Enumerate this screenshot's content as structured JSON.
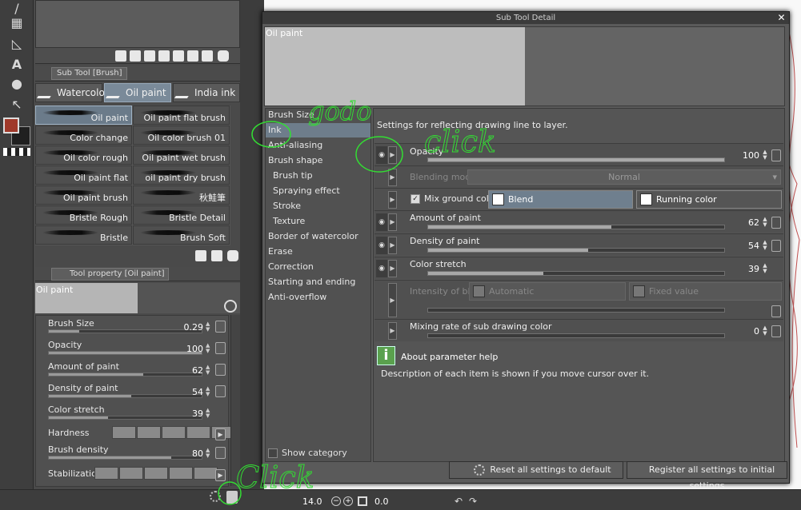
{
  "layer_strip": {},
  "subtool": {
    "tab_label": "Sub Tool [Brush]",
    "groups": [
      {
        "label": "Watercolor"
      },
      {
        "label": "Oil paint"
      },
      {
        "label": "India ink"
      }
    ],
    "brushes": [
      {
        "label": "Oil paint"
      },
      {
        "label": "Oil paint flat brush"
      },
      {
        "label": "Color change"
      },
      {
        "label": "Oil color brush 01"
      },
      {
        "label": "Oil color rough brush"
      },
      {
        "label": "Oil paint wet brush"
      },
      {
        "label": "Oil paint flat"
      },
      {
        "label": "oil paint dry brush"
      },
      {
        "label": "Oil paint brush"
      },
      {
        "label": "秋鮭筆"
      },
      {
        "label": "Bristle Rough"
      },
      {
        "label": "Bristle Detail"
      },
      {
        "label": "Bristle"
      },
      {
        "label": "Brush Soft"
      }
    ]
  },
  "tool_property": {
    "tab_label": "Tool property [Oil paint]",
    "preview_label": "Oil paint",
    "rows": [
      {
        "label": "Brush Size",
        "value": "0.29",
        "fill": 0.2
      },
      {
        "label": "Opacity",
        "value": "100",
        "fill": 1.0
      },
      {
        "label": "Amount of paint",
        "value": "62",
        "fill": 0.62
      },
      {
        "label": "Density of paint",
        "value": "54",
        "fill": 0.54
      },
      {
        "label": "Color stretch",
        "value": "39",
        "fill": 0.39
      },
      {
        "label": "Hardness"
      },
      {
        "label": "Brush density",
        "value": "80",
        "fill": 0.8
      },
      {
        "label": "Stabilization"
      }
    ]
  },
  "dialog": {
    "title": "Sub Tool Detail",
    "preview_label": "Oil paint",
    "categories": [
      {
        "label": "Brush Size"
      },
      {
        "label": "Ink"
      },
      {
        "label": "Anti-aliasing"
      },
      {
        "label": "Brush shape"
      },
      {
        "label": "Brush tip"
      },
      {
        "label": "Spraying effect"
      },
      {
        "label": "Stroke"
      },
      {
        "label": "Texture"
      },
      {
        "label": "Border of watercolor"
      },
      {
        "label": "Erase"
      },
      {
        "label": "Correction"
      },
      {
        "label": "Starting and ending"
      },
      {
        "label": "Anti-overflow"
      }
    ],
    "show_category": "Show category",
    "settings_desc": "Settings for reflecting drawing line to layer.",
    "params": {
      "opacity": {
        "label": "Opacity",
        "value": "100",
        "fill": 1.0
      },
      "blending_mode": {
        "label": "Blending mode",
        "value": "Normal"
      },
      "mix_ground": {
        "label": "Mix ground color",
        "blend": "Blend",
        "running": "Running color"
      },
      "amount": {
        "label": "Amount of paint",
        "value": "62",
        "fill": 0.62
      },
      "density": {
        "label": "Density of paint",
        "value": "54",
        "fill": 0.54
      },
      "stretch": {
        "label": "Color stretch",
        "value": "39",
        "fill": 0.39
      },
      "blur": {
        "label": "Intensity of blur",
        "auto": "Automatic",
        "fixed": "Fixed value"
      },
      "mixing_rate": {
        "label": "Mixing rate of sub drawing color",
        "value": "0",
        "fill": 0.0
      }
    },
    "help_title": "About parameter help",
    "help_desc": "Description of each item is shown if you move cursor over it.",
    "reset_btn": "Reset all settings to default",
    "register_btn": "Register all settings to initial settings"
  },
  "status": {
    "zoom": "14.0",
    "rotation": "0.0"
  },
  "annotations": {
    "click1": "click",
    "godo": "godo",
    "click2": "Click"
  },
  "colors": {
    "main_color": "#a0392a",
    "sub_color": "#202020",
    "accent": "#6e7d8b",
    "annotation_green": "#33dd33"
  }
}
